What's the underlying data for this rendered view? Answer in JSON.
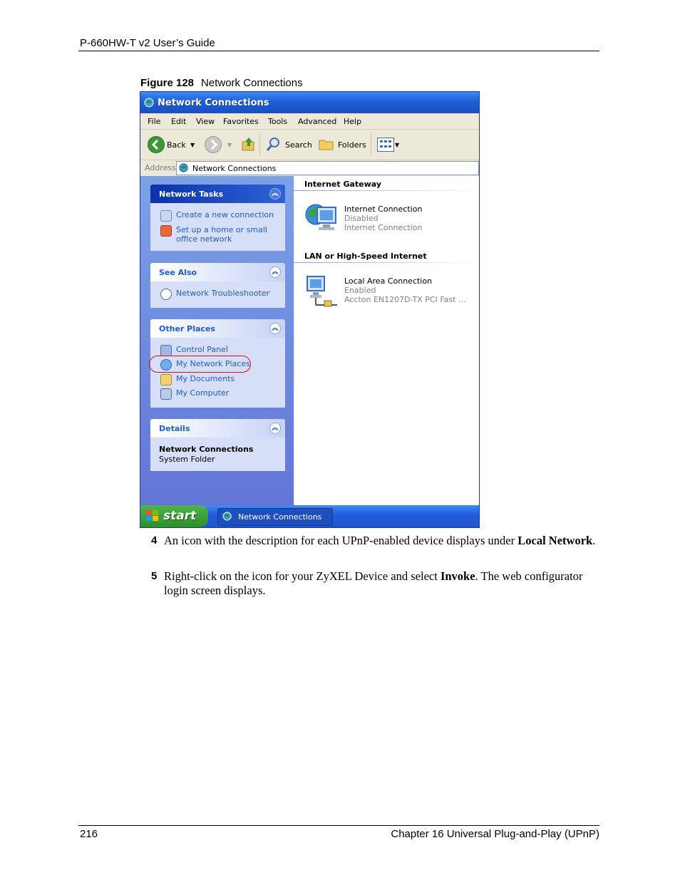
{
  "page": {
    "header": "P-660HW-T v2 User’s Guide",
    "footer_left": "216",
    "footer_right": "Chapter 16 Universal Plug-and-Play (UPnP)"
  },
  "figure": {
    "label": "Figure 128",
    "title": "Network Connections"
  },
  "window": {
    "title": "Network Connections",
    "menu": [
      "File",
      "Edit",
      "View",
      "Favorites",
      "Tools",
      "Advanced",
      "Help"
    ],
    "toolbar": {
      "back": "Back",
      "search": "Search",
      "folders": "Folders"
    },
    "address": {
      "label": "Address",
      "value": "Network Connections"
    },
    "panels": {
      "network_tasks": {
        "title": "Network Tasks",
        "items": [
          "Create a new connection",
          "Set up a home or small",
          "office network"
        ]
      },
      "see_also": {
        "title": "See Also",
        "items": [
          "Network Troubleshooter"
        ]
      },
      "other_places": {
        "title": "Other Places",
        "items": [
          "Control Panel",
          "My Network Places",
          "My Documents",
          "My Computer"
        ]
      },
      "details": {
        "title": "Details",
        "name": "Network Connections",
        "type": "System Folder"
      }
    },
    "groups": {
      "gateway": {
        "title": "Internet Gateway",
        "name": "Internet Connection",
        "status": "Disabled",
        "desc": "Internet Connection"
      },
      "lan": {
        "title": "LAN or High-Speed Internet",
        "name": "Local Area Connection",
        "status": "Enabled",
        "desc": "Accton EN1207D-TX PCI Fast ..."
      }
    },
    "taskbar": {
      "start": "start",
      "task": "Network Connections"
    },
    "highlight_color": "#e0101a"
  },
  "steps": [
    {
      "num": "4",
      "pre": "An icon with the description for each UPnP-enabled device displays under ",
      "bold": "Local Network",
      "post": "."
    },
    {
      "num": "5",
      "pre": "Right-click on the icon for your ZyXEL Device and select ",
      "bold": "Invoke",
      "post": ". The web configurator login screen displays."
    }
  ]
}
